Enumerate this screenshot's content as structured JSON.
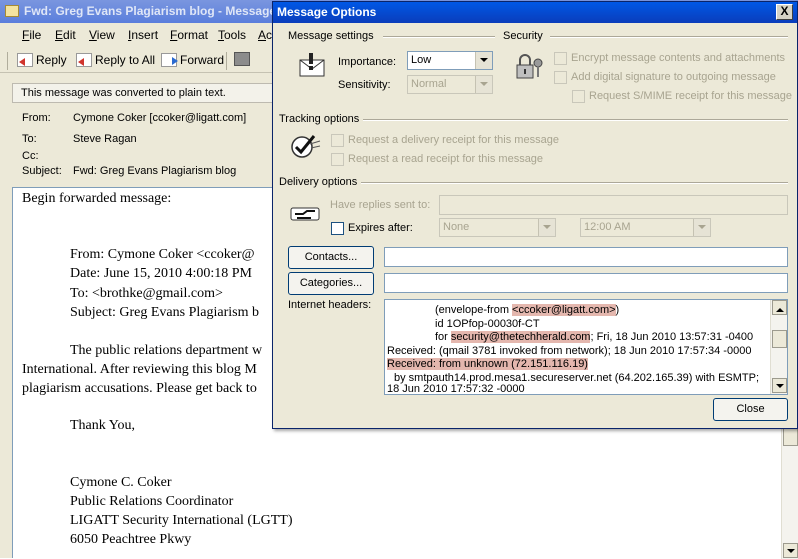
{
  "message_window": {
    "title": "Fwd: Greg Evans Plagiarism blog - Message (Plain Text)",
    "menu": [
      "File",
      "Edit",
      "View",
      "Insert",
      "Format",
      "Tools",
      "Ac"
    ],
    "toolbar": {
      "reply": "Reply",
      "reply_all": "Reply to All",
      "forward": "Forward"
    },
    "notice": "This message was converted to plain text.",
    "header": {
      "from_label": "From:",
      "from_value": "Cymone Coker [ccoker@ligatt.com]",
      "to_label": "To:",
      "to_value": "Steve Ragan",
      "cc_label": "Cc:",
      "cc_value": "",
      "subject_label": "Subject:",
      "subject_value": "Fwd: Greg Evans Plagiarism blog"
    },
    "body": {
      "line_begin": "Begin forwarded message:",
      "fwd_from": "From: Cymone Coker <ccoker@",
      "fwd_date": "Date: June 15, 2010 4:00:18 PM",
      "fwd_to": "To: <brothke@gmail.com>",
      "fwd_subject": "Subject: Greg Evans Plagiarism b",
      "para1": "The public relations department w",
      "para2": "International. After reviewing this blog M",
      "para3": "plagiarism accusations. Please get back to",
      "thanks": "Thank You,",
      "sig1": "Cymone C. Coker",
      "sig2": "Public Relations Coordinator",
      "sig3": "LIGATT Security International (LGTT)",
      "sig4": "6050 Peachtree Pkwy"
    }
  },
  "dialog": {
    "title": "Message Options",
    "close_glyph": "X",
    "message_settings": {
      "group_title": "Message settings",
      "importance_label": "Importance:",
      "importance_value": "Low",
      "sensitivity_label": "Sensitivity:",
      "sensitivity_value": "Normal"
    },
    "security": {
      "group_title": "Security",
      "encrypt": "Encrypt message contents and attachments",
      "signature": "Add digital signature to outgoing message",
      "smime": "Request S/MIME receipt for this message"
    },
    "tracking": {
      "group_title": "Tracking options",
      "delivery_receipt": "Request a delivery receipt for this message",
      "read_receipt": "Request a read receipt for this message"
    },
    "delivery": {
      "group_title": "Delivery options",
      "replies_label": "Have replies sent to:",
      "expires_label": "Expires after:",
      "expires_date": "None",
      "expires_time": "12:00 AM"
    },
    "contacts_button": "Contacts...",
    "categories_button": "Categories...",
    "internet_headers_label": "Internet headers:",
    "internet_headers": {
      "l1_pre": "(envelope-from ",
      "l1_hl": "<ccoker@ligatt.com>",
      "l1_post": ")",
      "l2": "id 1OPfop-00030f-CT",
      "l3_pre": "for ",
      "l3_hl": "security@thetechherald.com",
      "l3_post": "; Fri, 18 Jun 2010 13:57:31 -0400",
      "l4": "Received: (qmail 3781 invoked from network); 18 Jun 2010 17:57:34 -0000",
      "l5_hl": "Received: from unknown (72.151.116.19)",
      "l6": "by smtpauth14.prod.mesa1.secureserver.net (64.202.165.39) with ESMTP;",
      "l7": "18 Jun 2010 17:57:32 -0000"
    },
    "close_button": "Close"
  },
  "colors": {
    "title_active": "#0a3dbb",
    "dialog_face": "#ece9d8",
    "highlight": "#e4b7ae"
  }
}
